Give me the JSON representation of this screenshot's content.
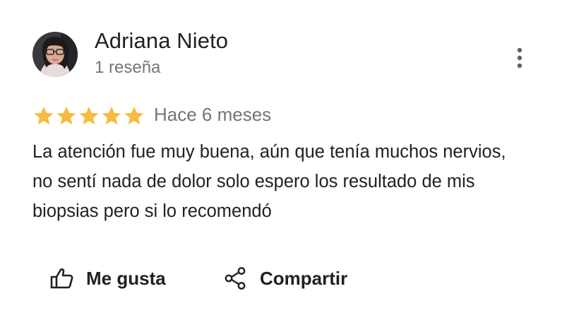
{
  "review": {
    "author_name": "Adriana Nieto",
    "author_review_count": "1 reseña",
    "rating": 5,
    "rating_max": 5,
    "star_color": "#f6bb3f",
    "date": "Hace 6 meses",
    "text": "La atención fue muy buena, aún que tenía muchos nervios, no sentí nada de dolor solo espero los resultado de mis biopsias pero si lo recomendó"
  },
  "actions": {
    "like_label": "Me gusta",
    "share_label": "Compartir"
  },
  "icons": {
    "more": "more-vert-icon",
    "like": "thumb-up-icon",
    "share": "share-icon"
  }
}
